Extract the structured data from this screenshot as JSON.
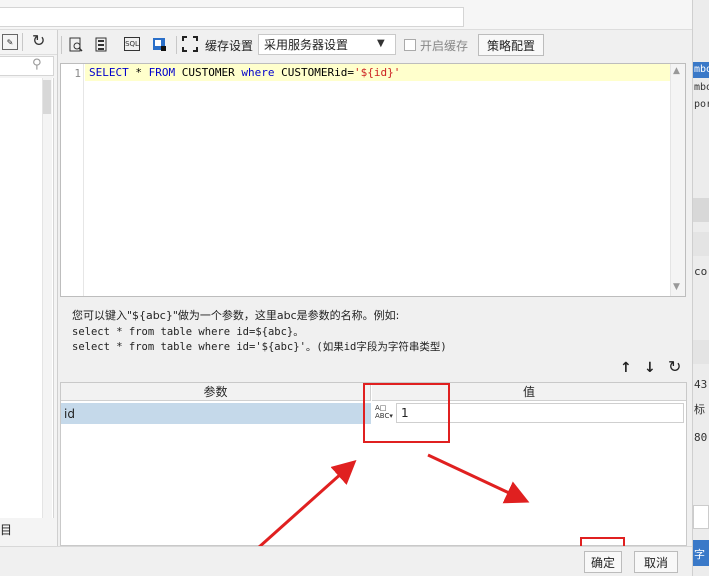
{
  "toolbar": {
    "cache_label": "缓存设置",
    "cache_select_value": "采用服务器设置",
    "enable_cache_label": "开启缓存",
    "strategy_button": "策略配置",
    "icons": [
      "preview-icon",
      "database-icon",
      "sql-icon",
      "export-icon",
      "fullscreen-icon"
    ]
  },
  "editor": {
    "line_number": "1",
    "tokens": [
      {
        "text": "SELECT",
        "type": "keyword"
      },
      {
        "text": " * ",
        "type": "plain"
      },
      {
        "text": "FROM",
        "type": "keyword"
      },
      {
        "text": " CUSTOMER ",
        "type": "plain"
      },
      {
        "text": "where",
        "type": "keyword"
      },
      {
        "text": " CUSTOMERid=",
        "type": "plain"
      },
      {
        "text": "'${id}'",
        "type": "string"
      }
    ]
  },
  "hint": {
    "line1": "您可以键入\"${abc}\"做为一个参数，这里abc是参数的名称。例如:",
    "line2": "select * from table where id=${abc}。",
    "line3": "select * from table where id='${abc}'。(如果id字段为字符串类型)"
  },
  "table": {
    "headers": {
      "param": "参数",
      "value": "值"
    },
    "rows": [
      {
        "param": "id",
        "value": "1"
      }
    ]
  },
  "footer": {
    "ok_button": "确定",
    "cancel_button": "取消"
  },
  "left_panel": {
    "bottom_text": "目"
  },
  "right_strip": {
    "texts": [
      "mbo",
      "mbo",
      "por",
      "cor",
      "43",
      "标",
      "80",
      "字"
    ]
  },
  "colors": {
    "keyword": "#0000cc",
    "string": "#cc2222",
    "annotation_red": "#e02020",
    "selected_row": "#c5d9ea"
  }
}
